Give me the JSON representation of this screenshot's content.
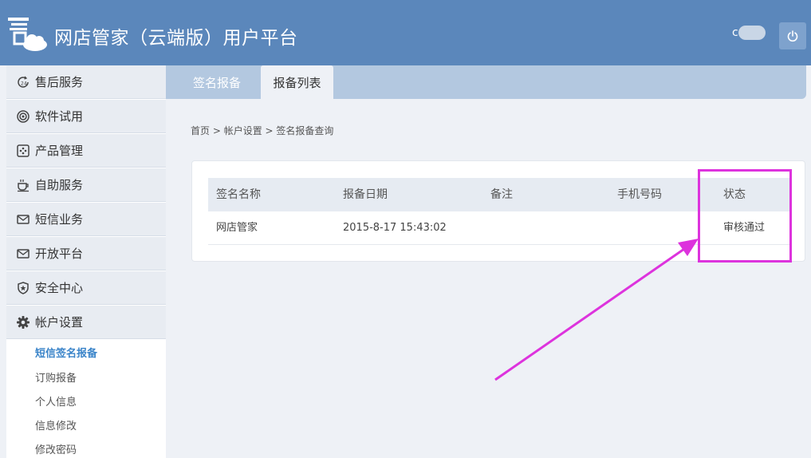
{
  "header": {
    "title": "网店管家（云端版）用户平台",
    "user_name": "c         1",
    "logo_icon": "logo-cloud-icon",
    "power_icon": "power-icon"
  },
  "sidebar": {
    "items": [
      {
        "label": "售后服务",
        "icon": "after-sales-24-icon"
      },
      {
        "label": "软件试用",
        "icon": "target-icon"
      },
      {
        "label": "产品管理",
        "icon": "product-box-icon"
      },
      {
        "label": "自助服务",
        "icon": "coffee-cup-icon"
      },
      {
        "label": "短信业务",
        "icon": "envelope-icon"
      },
      {
        "label": "开放平台",
        "icon": "envelope-icon"
      },
      {
        "label": "安全中心",
        "icon": "shield-icon"
      },
      {
        "label": "帐户设置",
        "icon": "gear-icon"
      }
    ],
    "subitems": [
      "短信签名报备",
      "订购报备",
      "个人信息",
      "信息修改",
      "修改密码"
    ]
  },
  "tabs": [
    "签名报备",
    "报备列表"
  ],
  "breadcrumb": {
    "home": "首页",
    "sep1": " > ",
    "level1": "帐户设置",
    "sep2": " > ",
    "level2": "签名报备查询"
  },
  "table": {
    "headers": [
      "签名名称",
      "报备日期",
      "备注",
      "手机号码",
      "状态"
    ],
    "rows": [
      [
        "网店管家",
        "2015-8-17 15:43:02",
        "",
        "",
        "审核通过"
      ]
    ]
  },
  "colors": {
    "header_bg": "#5b87bb",
    "accent": "#3a84c9",
    "annotation": "#dd33dd"
  }
}
